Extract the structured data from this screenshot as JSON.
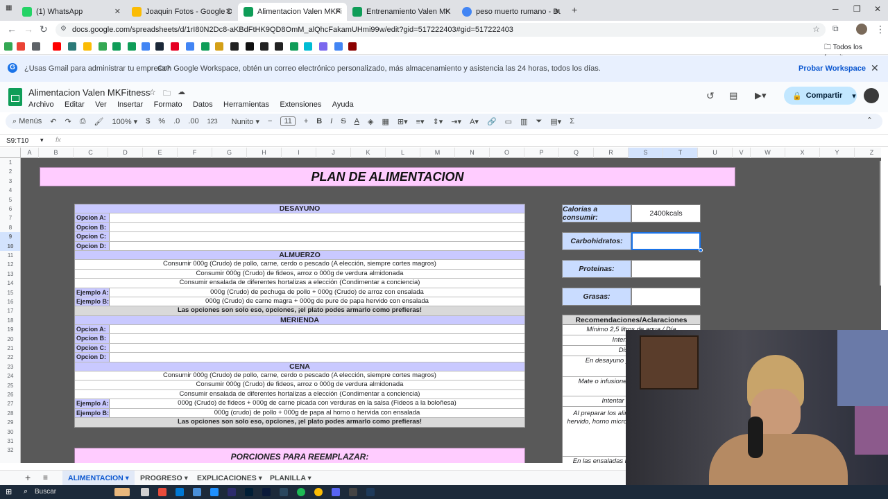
{
  "browser": {
    "tabs": [
      {
        "title": "(1) WhatsApp",
        "color": "#25d366"
      },
      {
        "title": "Joaquin Fotos - Google Drive",
        "color": "#fbbc04"
      },
      {
        "title": "Alimentacion Valen MKFitness",
        "color": "#0f9d58"
      },
      {
        "title": "Entrenamiento Valen MKFitness",
        "color": "#0f9d58"
      },
      {
        "title": "peso muerto rumano - Buscar c",
        "color": "#4285f4"
      }
    ],
    "url": "docs.google.com/spreadsheets/d/1rI80N2Dc8-aKBdFtHK9QD8OmM_alQhcFakamUHmi99w/edit?gid=517222403#gid=517222403",
    "bookmarks_all_label": "Todos los favoritos"
  },
  "banner": {
    "bold_text": "¿Usas Gmail para administrar tu empresa?",
    "text": "Con Google Workspace, obtén un correo electrónico personalizado, más almacenamiento y asistencia las 24 horas, todos los días.",
    "cta": "Probar Workspace"
  },
  "doc": {
    "title": "Alimentacion Valen MKFitness",
    "menu": [
      "Archivo",
      "Editar",
      "Ver",
      "Insertar",
      "Formato",
      "Datos",
      "Herramientas",
      "Extensiones",
      "Ayuda"
    ],
    "share_label": "Compartir"
  },
  "toolbar": {
    "menus_label": "Menús",
    "zoom": "100%",
    "currency": "$",
    "percent": "%",
    "dec_less": ".0",
    "dec_more": ".00",
    "number_fmt": "123",
    "font": "Nunito",
    "font_size": "11"
  },
  "formula": {
    "name_box": "S9:T10",
    "fx": "fx"
  },
  "grid": {
    "columns": [
      "A",
      "B",
      "C",
      "D",
      "E",
      "F",
      "G",
      "H",
      "I",
      "J",
      "K",
      "L",
      "M",
      "N",
      "O",
      "P",
      "Q",
      "R",
      "S",
      "T",
      "U",
      "V",
      "W",
      "X",
      "Y",
      "Z"
    ],
    "rows": [
      "1",
      "2",
      "3",
      "4",
      "5",
      "6",
      "7",
      "8",
      "9",
      "10",
      "11",
      "12",
      "13",
      "14",
      "15",
      "16",
      "17",
      "18",
      "19",
      "20",
      "21",
      "22",
      "23",
      "24",
      "25",
      "26",
      "27",
      "28",
      "29",
      "30",
      "31",
      "32"
    ]
  },
  "sheet": {
    "title": "PLAN DE ALIMENTACION",
    "desayuno": {
      "header": "DESAYUNO",
      "options": [
        {
          "label": "Opcion A:",
          "value": ""
        },
        {
          "label": "Opcion B:",
          "value": ""
        },
        {
          "label": "Opcion C:",
          "value": ""
        },
        {
          "label": "Opcion D:",
          "value": ""
        }
      ]
    },
    "almuerzo": {
      "header": "ALMUERZO",
      "lines": [
        "Consumir 000g (Crudo) de pollo, carne, cerdo o pescado (A elección, siempre cortes magros)",
        "Consumir 000g (Crudo) de fideos, arroz o 000g de verdura almidonada",
        "Consumir ensalada de diferentes hortalizas a elección (Condimentar a conciencia)"
      ],
      "examples": [
        {
          "label": "Ejemplo A:",
          "value": "000g (Crudo) de pechuga de pollo + 000g (Crudo) de arroz con ensalada"
        },
        {
          "label": "Ejemplo B:",
          "value": "000g (Crudo) de carne magra + 000g de pure de papa hervido con ensalada"
        }
      ],
      "note": "Las opciones son solo eso, opciones, ¡el plato podes armarlo como prefieras!"
    },
    "merienda": {
      "header": "MERIENDA",
      "options": [
        {
          "label": "Opcion A:",
          "value": ""
        },
        {
          "label": "Opcion B:",
          "value": ""
        },
        {
          "label": "Opcion C:",
          "value": ""
        },
        {
          "label": "Opcion D:",
          "value": ""
        }
      ]
    },
    "cena": {
      "header": "CENA",
      "lines": [
        "Consumir 000g (Crudo) de pollo, carne, cerdo o pescado (A elección, siempre cortes magros)",
        "Consumir 000g (Crudo) de fideos, arroz o 000g de verdura almidonada",
        "Consumir ensalada de diferentes hortalizas a elección (Condimentar a conciencia)"
      ],
      "examples": [
        {
          "label": "Ejemplo A:",
          "value": "000g (Crudo) de fideos + 000g de carne picada con verduras en la salsa (Fideos a la boloñesa)"
        },
        {
          "label": "Ejemplo B:",
          "value": "000g (crudo) de pollo + 000g de papa al horno o hervida con ensalada"
        }
      ],
      "note": "Las opciones son solo eso, opciones, ¡el plato podes armarlo como prefieras!"
    },
    "porciones_title": "PORCIONES PARA REEMPLAZAR:",
    "macros": [
      {
        "label": "Calorias a consumir:",
        "value": "2400kcals"
      },
      {
        "label": "Carbohidratos:",
        "value": ""
      },
      {
        "label": "Proteinas:",
        "value": ""
      },
      {
        "label": "Grasas:",
        "value": ""
      }
    ],
    "recs": {
      "header": "Recomendaciones/Aclaraciones",
      "items": [
        "Mínimo 2,5 litros de agua / Día",
        "Intentar evita",
        "Disminui",
        "En desayuno y meri infusion qu",
        "Mate o infusiones l podes usar endu",
        "Intentar evitar fritura",
        "Al preparar los alim de cocción que no r hervido, horno microondas). Para aceite por",
        "En las ensaladas p mediana de aceite d"
      ]
    }
  },
  "sheet_tabs": [
    "ALIMENTACION",
    "PROGRESO",
    "EXPLICACIONES",
    "PLANILLA"
  ],
  "taskbar": {
    "search": "Buscar"
  }
}
